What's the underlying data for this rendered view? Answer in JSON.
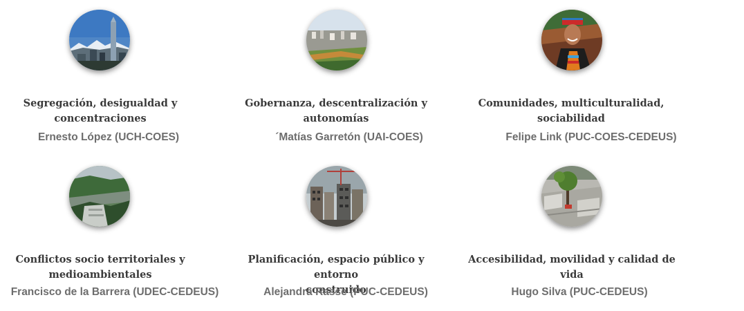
{
  "lines": [
    {
      "title": "Segregación, desigualdad y\nconcentraciones",
      "person": "Ernesto López (UCH-COES)",
      "image": "city-skyline-mountains-photo"
    },
    {
      "title": "Gobernanza, descentralización y\nautonomías",
      "person": "´Matías Garretón (UAI-COES)",
      "image": "city-aerial-river-photo"
    },
    {
      "title": "Comunidades, multiculturalidad,\nsociabilidad",
      "person": "Felipe Link (PUC-COES-CEDEUS)",
      "image": "indigenous-woman-portrait-photo"
    },
    {
      "title": "Conflictos socio territoriales y\nmedioambientales",
      "person": "Francisco de la Barrera (UDEC-CEDEUS)",
      "image": "dam-valley-photo"
    },
    {
      "title": "Planificación, espacio público y entorno\nconstruido",
      "person": "Alejandra Rasse (PUC-CEDEUS)",
      "image": "construction-buildings-photo"
    },
    {
      "title": "Accesibilidad, movilidad y calidad de\nvida",
      "person": "Hugo Silva (PUC-CEDEUS)",
      "image": "plaza-trees-photo"
    }
  ]
}
